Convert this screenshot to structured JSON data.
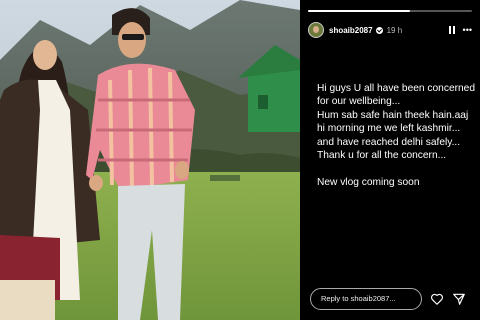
{
  "story": {
    "progress_fraction": 0.62,
    "username": "shoaib2087",
    "time": "19 h",
    "verified_icon": "verified-badge-icon",
    "pause_icon": "pause-icon",
    "more_icon": "more-options-icon",
    "more_label": "•••",
    "message": "Hi guys U all have been concerned for our wellbeing...\nHum sab safe hain theek hain.aaj hi morning me we left kashmir... and have reached delhi safely...\nThank u for all the concern...\n\nNew vlog coming soon",
    "reply_placeholder": "Reply to shoaib2087...",
    "heart_icon": "heart-icon",
    "send_icon": "send-icon"
  },
  "colors": {
    "story_bg": "#000000",
    "text": "#ffffff",
    "progress_track": "#555555"
  }
}
